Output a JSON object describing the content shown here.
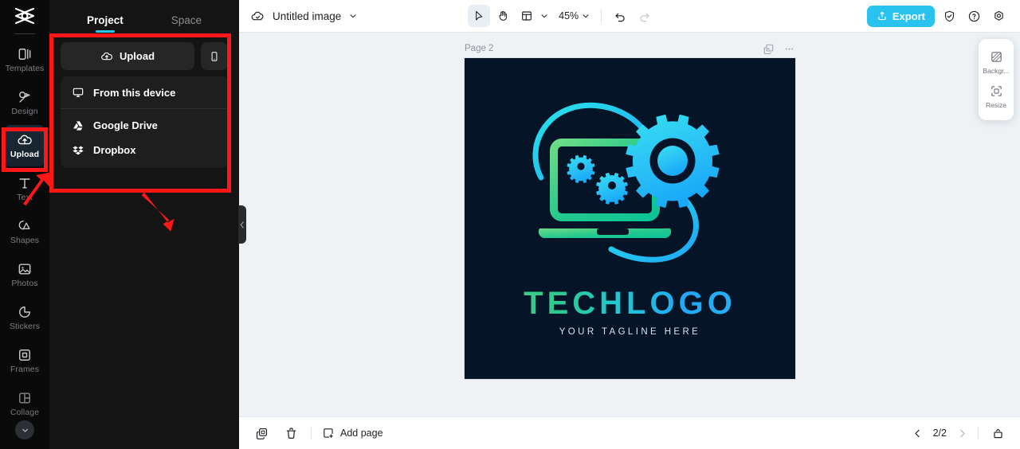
{
  "app": {
    "logo_icon": "capcut-logo-icon"
  },
  "rail": {
    "items": [
      {
        "label": "Templates",
        "icon": "templates-icon",
        "active": false
      },
      {
        "label": "Design",
        "icon": "design-icon",
        "active": false
      },
      {
        "label": "Upload",
        "icon": "upload-cloud-icon",
        "active": true
      },
      {
        "label": "Text",
        "icon": "text-icon",
        "active": false
      },
      {
        "label": "Shapes",
        "icon": "shapes-icon",
        "active": false
      },
      {
        "label": "Photos",
        "icon": "photos-icon",
        "active": false
      },
      {
        "label": "Stickers",
        "icon": "stickers-icon",
        "active": false
      },
      {
        "label": "Frames",
        "icon": "frames-icon",
        "active": false
      },
      {
        "label": "Collage",
        "icon": "collage-icon",
        "active": false
      }
    ],
    "expand_icon": "chevron-down-icon"
  },
  "panel": {
    "tabs": [
      {
        "label": "Project",
        "selected": true
      },
      {
        "label": "Space",
        "selected": false
      }
    ],
    "upload_button": "Upload",
    "upload_icon": "upload-cloud-icon",
    "mobile_icon": "mobile-phone-icon",
    "menu": [
      {
        "label": "From this device",
        "icon": "monitor-icon"
      },
      {
        "label": "Google Drive",
        "icon": "google-drive-icon"
      },
      {
        "label": "Dropbox",
        "icon": "dropbox-icon"
      }
    ]
  },
  "topbar": {
    "cloud_icon": "cloud-saved-icon",
    "doc_title": "Untitled image",
    "doc_chevron": "chevron-down-icon",
    "tools": [
      {
        "name": "select-tool",
        "icon": "cursor-arrow-icon",
        "selected": true
      },
      {
        "name": "hand-tool",
        "icon": "hand-icon",
        "selected": false
      },
      {
        "name": "layout-tool",
        "icon": "layout-grid-icon",
        "selected": false
      }
    ],
    "zoom_value": "45%",
    "zoom_chevron": "chevron-down-icon",
    "undo_icon": "undo-icon",
    "redo_icon": "redo-icon",
    "export_label": "Export",
    "export_icon": "export-upload-icon",
    "export_color": "#2ac3f0",
    "right_icons": [
      {
        "name": "shield-check-icon"
      },
      {
        "name": "help-circle-icon"
      },
      {
        "name": "settings-gear-icon"
      }
    ]
  },
  "canvas": {
    "page_label": "Page 2",
    "duplicate_icon": "duplicate-page-icon",
    "more_icon": "more-options-icon",
    "artboard_bg": "#051427",
    "artwork": {
      "name": "tech-logo-artwork",
      "brand_name": "TECHLOGO",
      "tagline": "YOUR TAGLINE HERE",
      "gradient_from": "#4fd37a",
      "gradient_to": "#22a8f5"
    }
  },
  "right_panel": {
    "items": [
      {
        "label": "Backgr...",
        "icon": "background-icon"
      },
      {
        "label": "Resize",
        "icon": "resize-icon"
      }
    ]
  },
  "bottombar": {
    "duplicate_icon": "duplicate-icon",
    "delete_icon": "trash-icon",
    "add_page_label": "Add page",
    "add_page_icon": "add-page-icon",
    "prev_icon": "chevron-left-icon",
    "next_icon": "chevron-right-icon",
    "page_indicator": "2/2",
    "timeline_icon": "page-manager-icon"
  },
  "annotations": {
    "highlight_color": "#ff1616",
    "boxes": [
      "upload-panel-highlight",
      "upload-rail-highlight"
    ],
    "arrows": [
      "arrow-to-upload-rail",
      "arrow-to-upload-panel"
    ]
  }
}
